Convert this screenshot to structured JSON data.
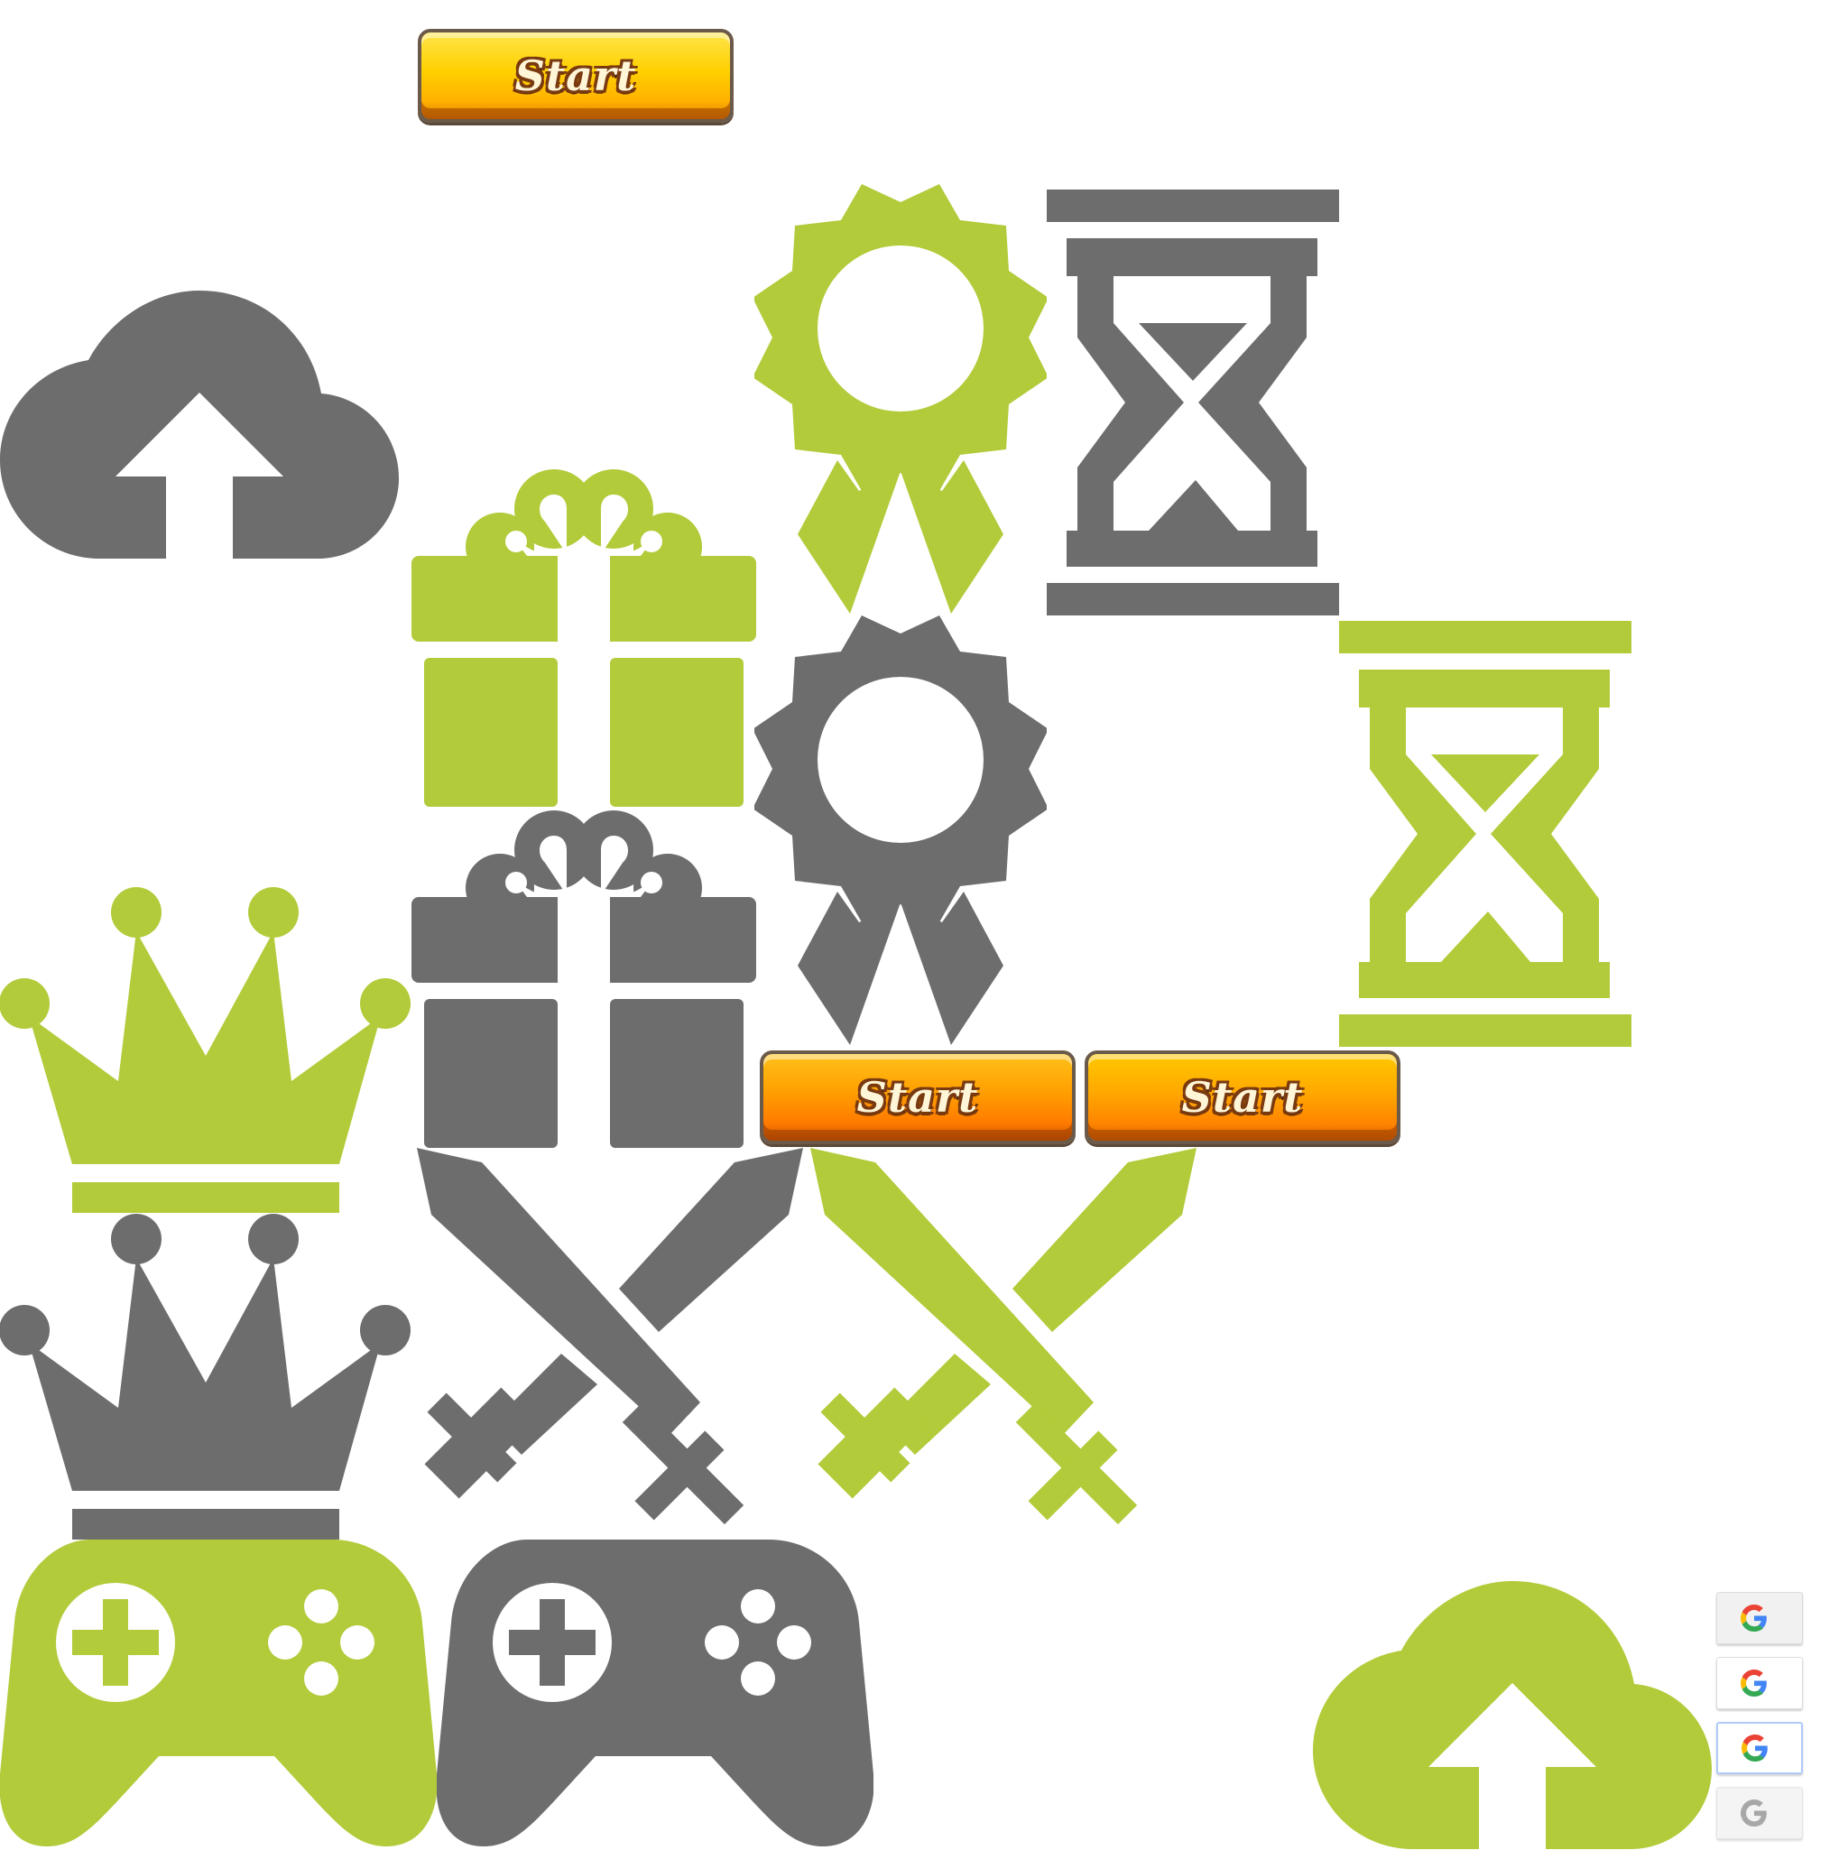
{
  "colors": {
    "green": "#b2cb3a",
    "gray": "#6d6d6d",
    "button_yellow": "#ffd000",
    "button_orange": "#ff8c00"
  },
  "buttons": {
    "start_top": "Start",
    "start_middle_left": "Start",
    "start_middle_right": "Start"
  },
  "icons": [
    "cloud-upload-icon",
    "gift-icon",
    "award-badge-icon",
    "hourglass-icon",
    "crown-icon",
    "crossed-swords-icon",
    "gamepad-icon",
    "google-g-icon"
  ],
  "google_buttons": [
    {
      "state": "normal"
    },
    {
      "state": "pressed"
    },
    {
      "state": "focused"
    },
    {
      "state": "disabled"
    }
  ]
}
